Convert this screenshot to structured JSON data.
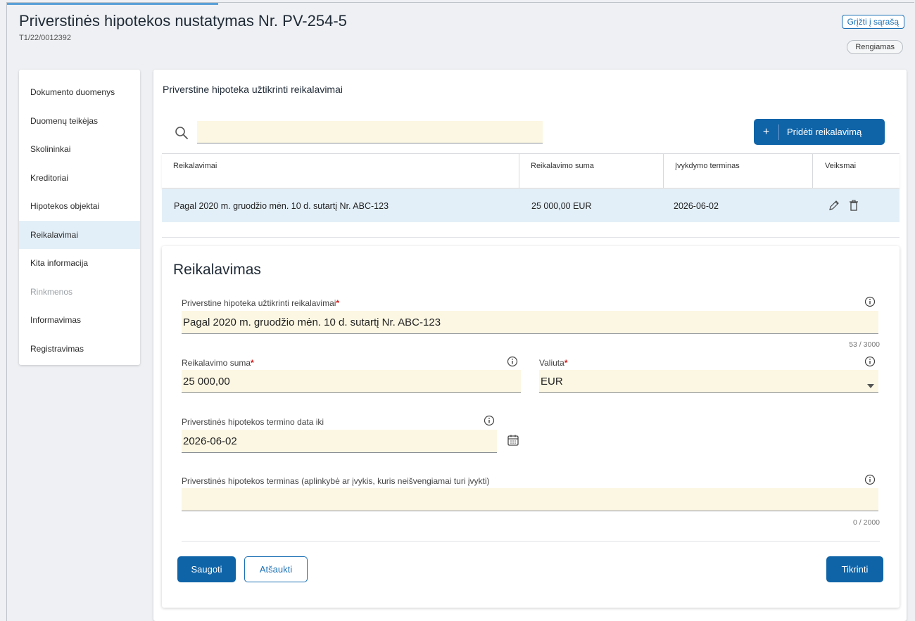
{
  "header": {
    "title": "Priverstinės hipotekos nustatymas Nr. PV-254-5",
    "subtitle": "T1/22/0012392",
    "back_link": "Grįžti į sąrašą",
    "status": "Rengiamas"
  },
  "sidebar": {
    "items": [
      {
        "label": "Dokumento duomenys",
        "state": "normal"
      },
      {
        "label": "Duomenų teikėjas",
        "state": "normal"
      },
      {
        "label": "Skolininkai",
        "state": "normal"
      },
      {
        "label": "Kreditoriai",
        "state": "normal"
      },
      {
        "label": "Hipotekos objektai",
        "state": "normal"
      },
      {
        "label": "Reikalavimai",
        "state": "active"
      },
      {
        "label": "Kita informacija",
        "state": "normal"
      },
      {
        "label": "Rinkmenos",
        "state": "disabled"
      },
      {
        "label": "Informavimas",
        "state": "normal"
      },
      {
        "label": "Registravimas",
        "state": "normal"
      }
    ]
  },
  "main": {
    "section_title": "Priverstine hipoteka užtikrinti reikalavimai",
    "search": {
      "value": "",
      "icon": "search-icon"
    },
    "add_button": {
      "plus": "+",
      "label": "Pridėti reikalavimą"
    },
    "table": {
      "columns": [
        "Reikalavimai",
        "Reikalavimo suma",
        "Įvykdymo terminas",
        "Veiksmai"
      ],
      "rows": [
        {
          "claim": "Pagal 2020 m. gruodžio mėn. 10 d. sutartį Nr. ABC-123",
          "amount": "25 000,00  EUR",
          "due": "2026-06-02",
          "actions": [
            "edit-icon",
            "delete-icon"
          ]
        }
      ]
    }
  },
  "form": {
    "title": "Reikalavimas",
    "claim_label": "Priverstine hipoteka užtikrinti reikalavimai",
    "claim_value": "Pagal 2020 m. gruodžio mėn. 10 d. sutartį Nr. ABC-123",
    "claim_counter": "53 / 3000",
    "amount_label": "Reikalavimo suma",
    "amount_value": "25 000,00",
    "currency_label": "Valiuta",
    "currency_value": "EUR",
    "date_label": "Priverstinės hipotekos termino data iki",
    "date_value": "2026-06-02",
    "term_label": "Priverstinės hipotekos terminas (aplinkybė ar įvykis, kuris neišvengiamai turi įvykti)",
    "term_value": "",
    "term_counter": "0 / 2000",
    "required_mark": "*",
    "save_button": "Saugoti",
    "cancel_button": "Atšaukti",
    "check_button": "Tikrinti"
  },
  "colors": {
    "accent": "#0f64a8",
    "active_bg": "#e3eff8",
    "input_bg": "#fcf7e3",
    "required": "#d31a1a"
  }
}
